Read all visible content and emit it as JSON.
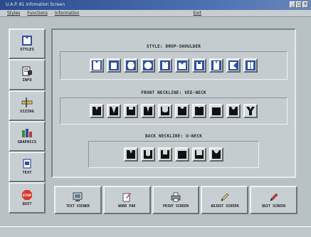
{
  "window": {
    "title": "U.A.P. 81 infomation Screen"
  },
  "menu": {
    "items": [
      "Styles",
      "Functions",
      "Information"
    ],
    "help": "Exit"
  },
  "sidebar": {
    "items": [
      {
        "label": "STYLES",
        "icon": "garment-icon"
      },
      {
        "label": "INFO",
        "icon": "info-sheet-icon"
      },
      {
        "label": "SIZING",
        "icon": "ruler-icon"
      },
      {
        "label": "GRAPHICS",
        "icon": "graphics-icon"
      },
      {
        "label": "TEXT",
        "icon": "text-page-icon"
      },
      {
        "label": "QUIT",
        "icon": "stop-sign-icon"
      }
    ]
  },
  "sections": {
    "style": {
      "title": "STYLE: DROP-SHOULDER"
    },
    "front": {
      "title": "FRONT NECKLINE: VEE-NECK"
    },
    "back": {
      "title": "BACK NECKLINE: U-NECK"
    }
  },
  "toolbar": {
    "items": [
      {
        "label": "TEXT VIEWER",
        "icon": "monitor-icon"
      },
      {
        "label": "WORD PAD",
        "icon": "notepad-icon"
      },
      {
        "label": "PRINT SCREEN",
        "icon": "printer-icon"
      },
      {
        "label": "ADJUST SCREEN",
        "icon": "pencil-icon"
      },
      {
        "label": "QUIT SCREEN",
        "icon": "red-pencil-icon"
      }
    ]
  },
  "colors": {
    "accent": "#2a4a8c",
    "face": "#c8cfd2",
    "garment": "#2f4fa0",
    "neckline": "#111111",
    "stop": "#d83a2e"
  }
}
